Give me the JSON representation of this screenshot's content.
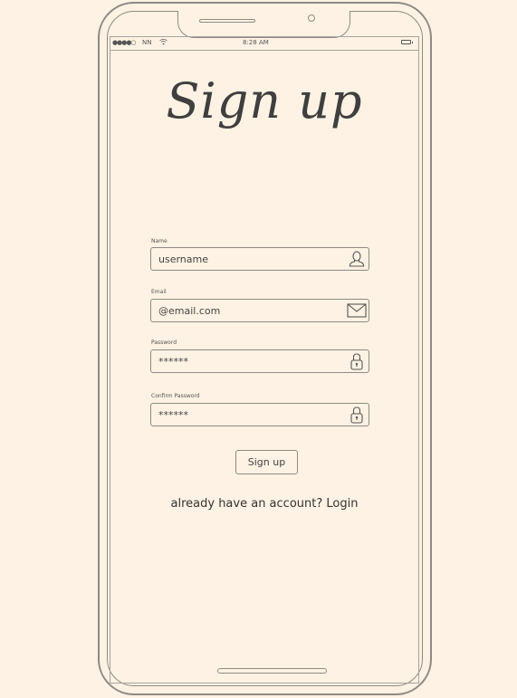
{
  "status_bar": {
    "signal": "●●●●○",
    "carrier": "NN",
    "time": "8:28 AM"
  },
  "title": "Sign up",
  "fields": [
    {
      "label": "Name",
      "value": "username",
      "icon": "user-icon"
    },
    {
      "label": "Email",
      "value": "@email.com",
      "icon": "envelope-icon"
    },
    {
      "label": "Password",
      "value": "******",
      "icon": "lock-icon"
    },
    {
      "label": "Confirm Password",
      "value": "******",
      "icon": "lock-icon"
    }
  ],
  "signup_button": "Sign up",
  "login_prompt": "already have an account? Login"
}
